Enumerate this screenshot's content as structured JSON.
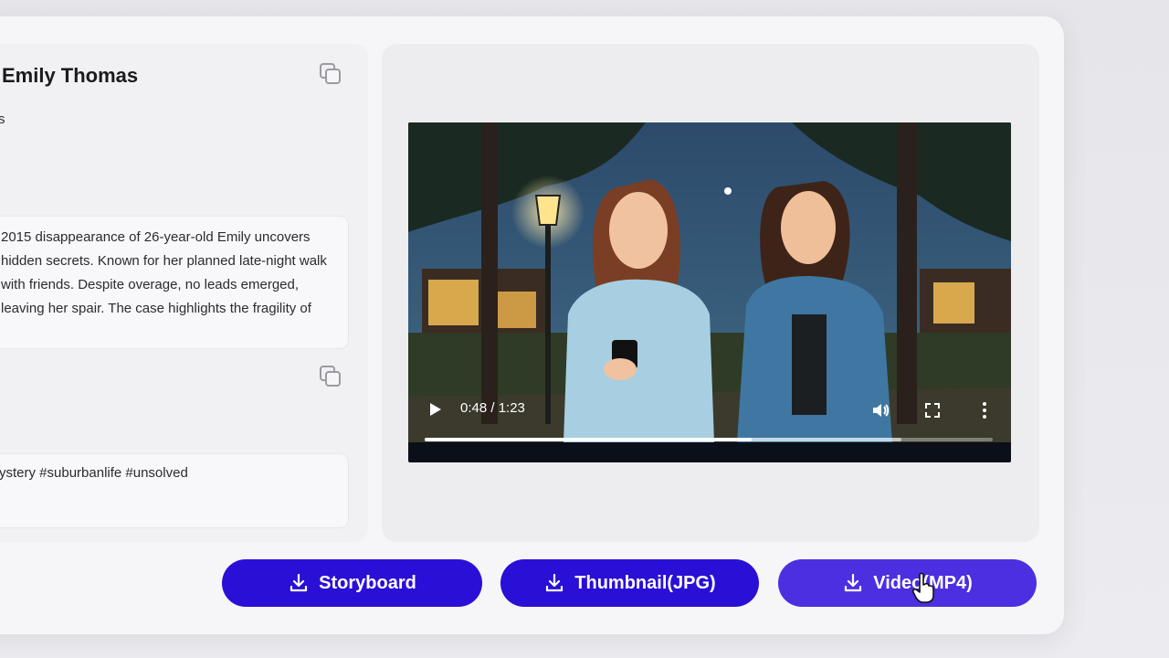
{
  "profile": {
    "title": "Emily Thomas",
    "subtitle": "s"
  },
  "description": {
    "text": "2015 disappearance of 26-year-old Emily uncovers hidden secrets. Known for her planned late-night walk with friends. Despite overage, no leads emerged, leaving her spair. The case highlights the fragility of"
  },
  "tags": {
    "text": "ystery #suburbanlife #unsolved"
  },
  "video": {
    "time": "0:48 / 1:23",
    "progress": 0.575,
    "buffered": 0.84
  },
  "buttons": {
    "storyboard": "Storyboard",
    "thumbnail": "Thumbnail(JPG)",
    "video": "Video(MP4)"
  },
  "colors": {
    "button": "#2a0fd6",
    "button_active": "#4b2fe0"
  }
}
